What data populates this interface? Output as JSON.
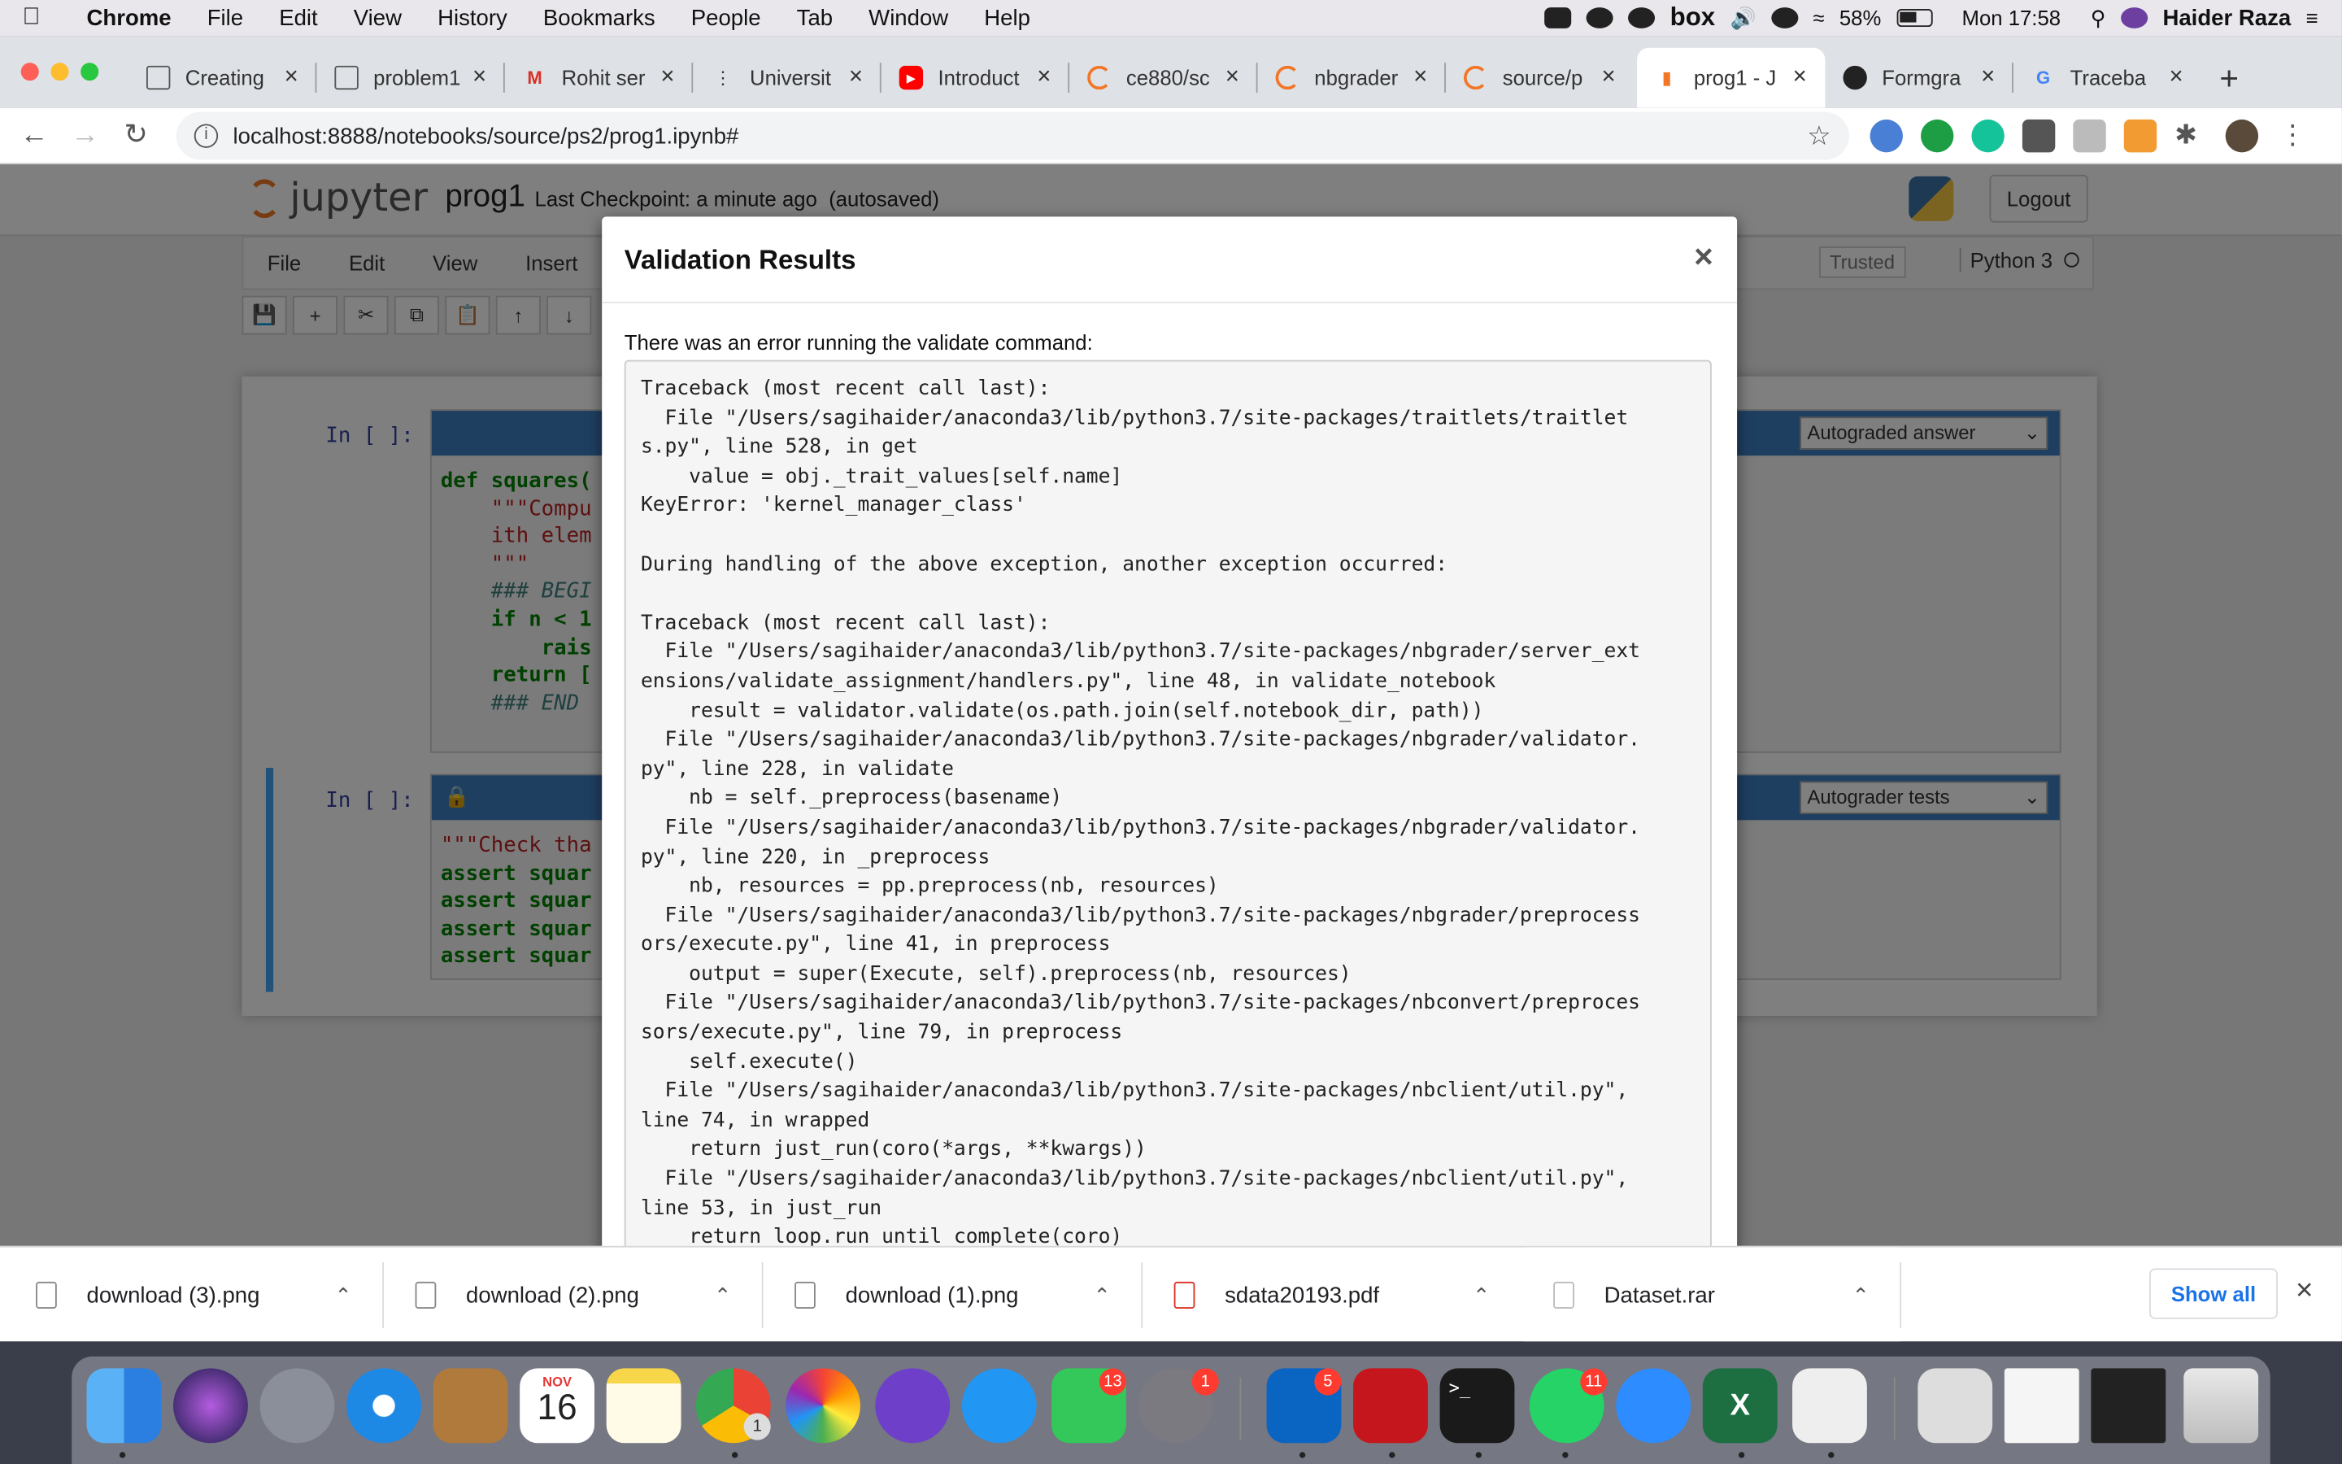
{
  "menubar": {
    "app": "Chrome",
    "items": [
      "File",
      "Edit",
      "View",
      "History",
      "Bookmarks",
      "People",
      "Tab",
      "Window",
      "Help"
    ],
    "battery": "58%",
    "clock": "Mon 17:58",
    "user": "Haider Raza"
  },
  "tabs": [
    {
      "label": "Creating",
      "icon": "doc-icon"
    },
    {
      "label": "problem1",
      "icon": "doc-icon"
    },
    {
      "label": "Rohit ser",
      "icon": "gmail-icon"
    },
    {
      "label": "Universit",
      "icon": "ellipsis-icon"
    },
    {
      "label": "Introduct",
      "icon": "youtube-icon"
    },
    {
      "label": "ce880/sc",
      "icon": "jupyter-icon"
    },
    {
      "label": "nbgrader",
      "icon": "jupyter-icon"
    },
    {
      "label": "source/p",
      "icon": "jupyter-icon"
    },
    {
      "label": "prog1 - J",
      "icon": "notebook-icon"
    },
    {
      "label": "Formgra",
      "icon": "github-icon"
    },
    {
      "label": "Traceba",
      "icon": "google-icon"
    }
  ],
  "address": {
    "url": "localhost:8888/notebooks/source/ps2/prog1.ipynb#"
  },
  "jupyter": {
    "logo": "jupyter",
    "notebook_name": "prog1",
    "checkpoint": "Last Checkpoint: a minute ago",
    "autosave": "(autosaved)",
    "logout": "Logout",
    "menu": [
      "File",
      "Edit",
      "View",
      "Insert"
    ],
    "trusted": "Trusted",
    "kernel": "Python 3",
    "cells": [
      {
        "prompt": "In [ ]:",
        "type": "Autograded answer",
        "code": [
          "def squares(",
          "    \"\"\"Compu",
          "    ith elem",
          "",
          "    \"\"\"",
          "    ### BEGI",
          "    if n < 1",
          "        rais",
          "    return [",
          "    ### END"
        ]
      },
      {
        "prompt": "In [ ]:",
        "type": "Autograder tests",
        "code": [
          "\"\"\"Check tha",
          "assert squar",
          "assert squar",
          "assert squar",
          "assert squar"
        ]
      }
    ]
  },
  "modal": {
    "title": "Validation Results",
    "close": "×",
    "intro": "There was an error running the validate command:",
    "traceback": [
      "Traceback (most recent call last):",
      "  File \"/Users/sagihaider/anaconda3/lib/python3.7/site-packages/traitlets/traitlet",
      "s.py\", line 528, in get",
      "    value = obj._trait_values[self.name]",
      "KeyError: 'kernel_manager_class'",
      "",
      "During handling of the above exception, another exception occurred:",
      "",
      "Traceback (most recent call last):",
      "  File \"/Users/sagihaider/anaconda3/lib/python3.7/site-packages/nbgrader/server_ext",
      "ensions/validate_assignment/handlers.py\", line 48, in validate_notebook",
      "    result = validator.validate(os.path.join(self.notebook_dir, path))",
      "  File \"/Users/sagihaider/anaconda3/lib/python3.7/site-packages/nbgrader/validator.",
      "py\", line 228, in validate",
      "    nb = self._preprocess(basename)",
      "  File \"/Users/sagihaider/anaconda3/lib/python3.7/site-packages/nbgrader/validator.",
      "py\", line 220, in _preprocess",
      "    nb, resources = pp.preprocess(nb, resources)",
      "  File \"/Users/sagihaider/anaconda3/lib/python3.7/site-packages/nbgrader/preprocess",
      "ors/execute.py\", line 41, in preprocess",
      "    output = super(Execute, self).preprocess(nb, resources)",
      "  File \"/Users/sagihaider/anaconda3/lib/python3.7/site-packages/nbconvert/preproces",
      "sors/execute.py\", line 79, in preprocess",
      "    self.execute()",
      "  File \"/Users/sagihaider/anaconda3/lib/python3.7/site-packages/nbclient/util.py\",",
      "line 74, in wrapped",
      "    return just_run(coro(*args, **kwargs))",
      "  File \"/Users/sagihaider/anaconda3/lib/python3.7/site-packages/nbclient/util.py\",",
      "line 53, in just_run",
      "    return loop.run_until_complete(coro)"
    ]
  },
  "downloads": {
    "items": [
      {
        "name": "download (3).png",
        "kind": "png"
      },
      {
        "name": "download (2).png",
        "kind": "png"
      },
      {
        "name": "download (1).png",
        "kind": "png"
      },
      {
        "name": "sdata20193.pdf",
        "kind": "pdf"
      },
      {
        "name": "Dataset.rar",
        "kind": "rar"
      }
    ],
    "show_all": "Show all"
  },
  "dock": {
    "calendar_month": "NOV",
    "calendar_day": "16",
    "badges": {
      "facetime": "13",
      "settings": "1",
      "outlook": "5",
      "whatsapp": "11",
      "chrome": "1"
    }
  }
}
